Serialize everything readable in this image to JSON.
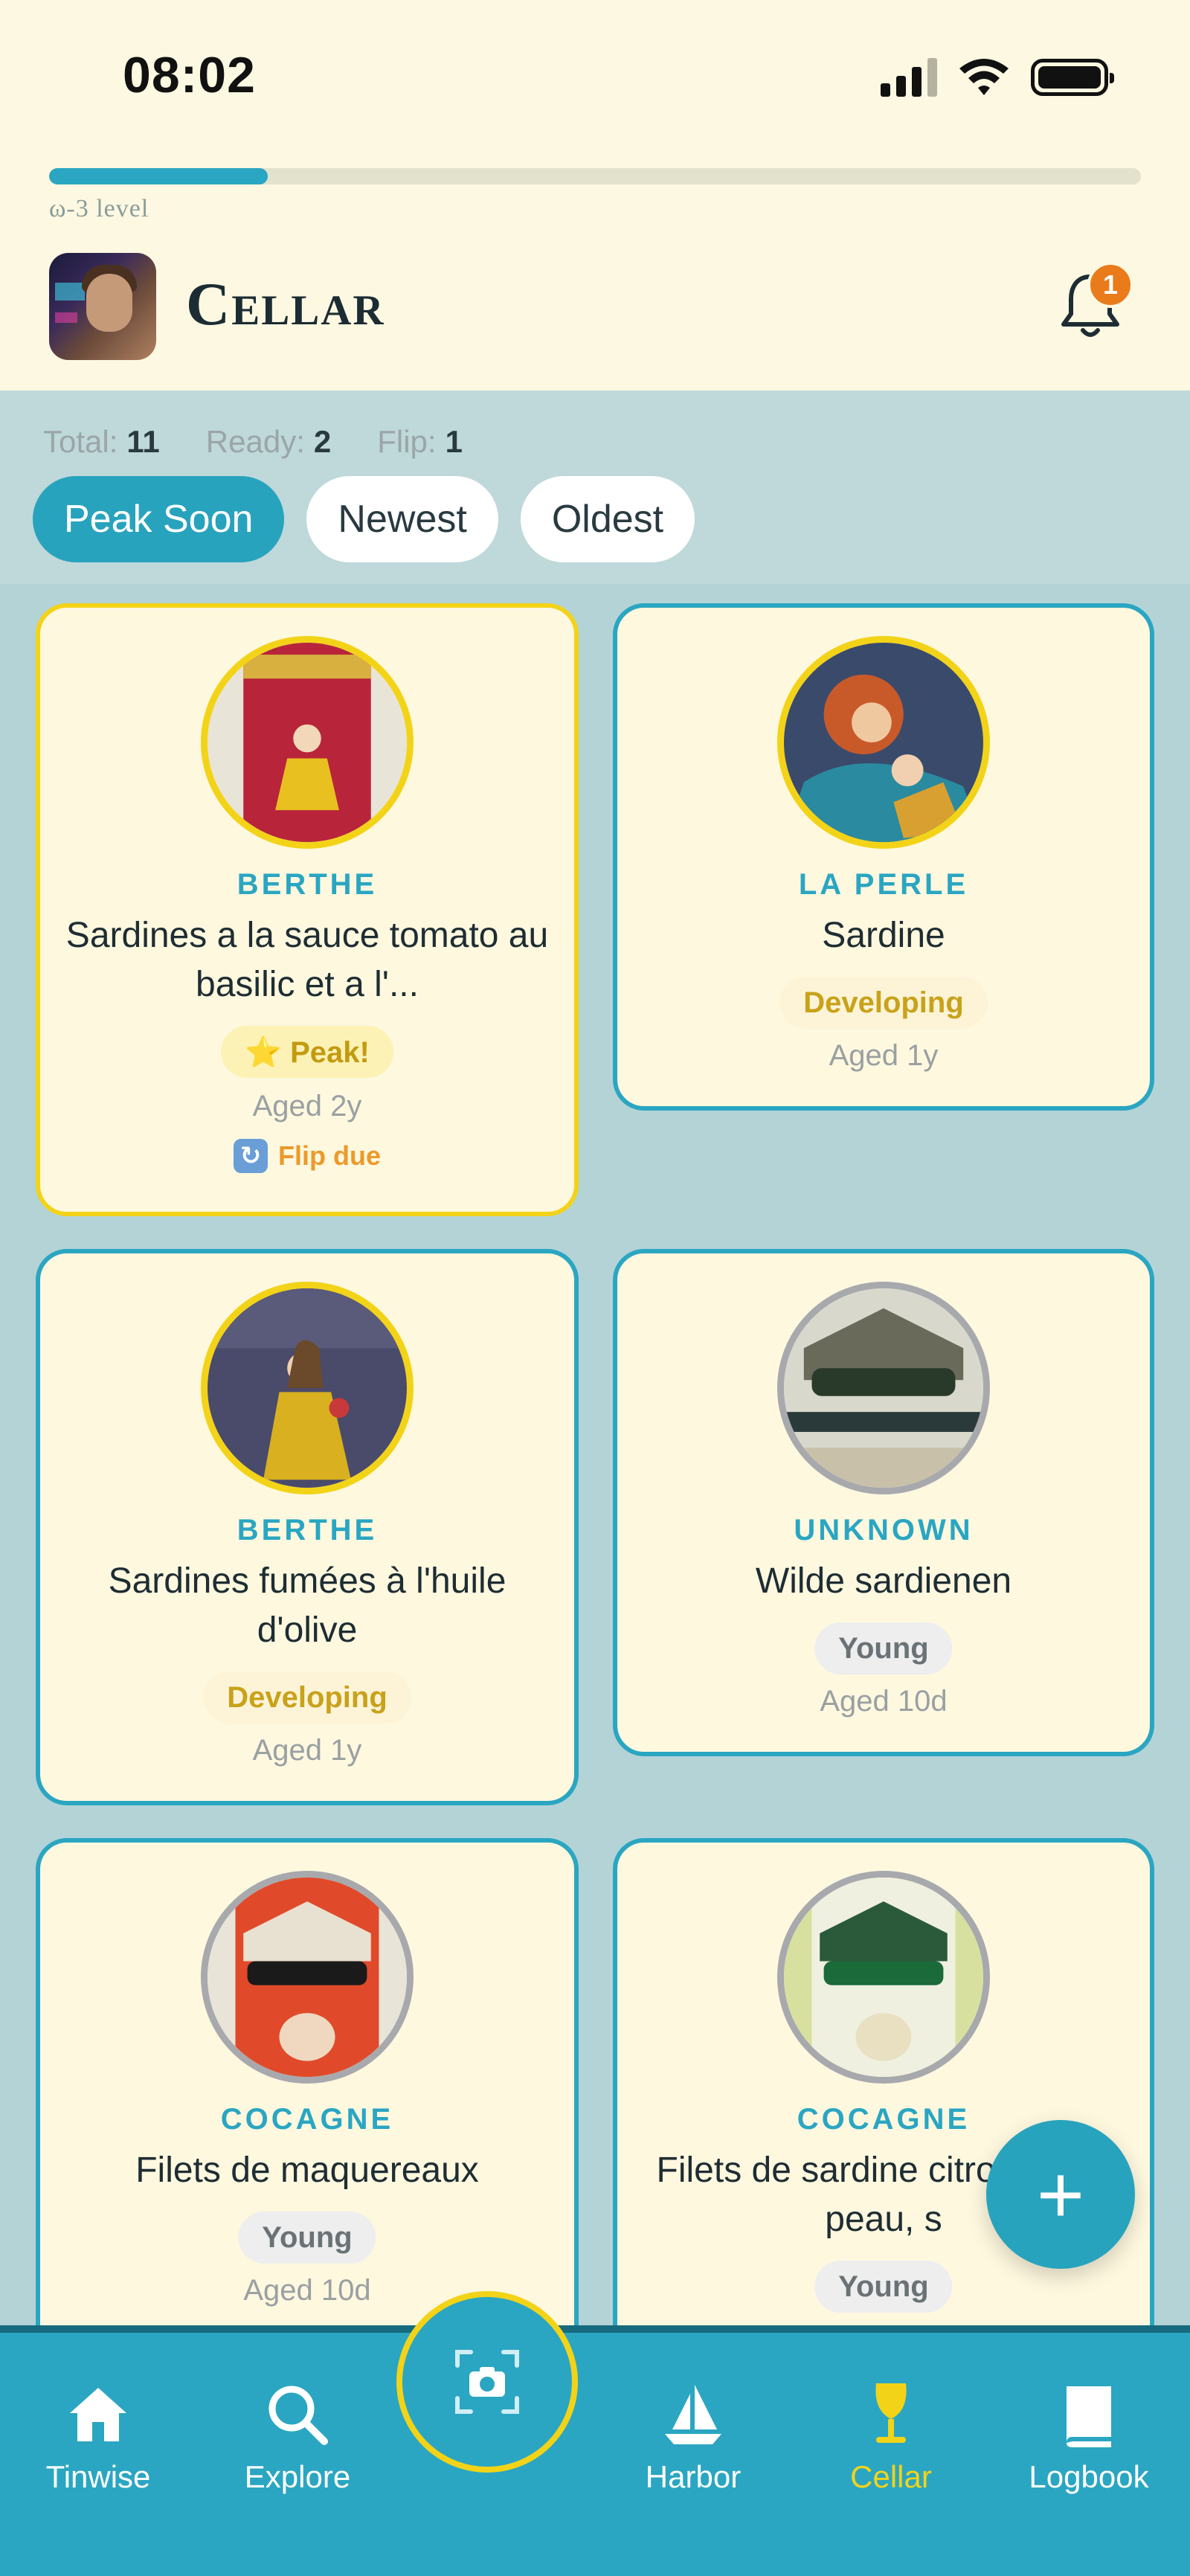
{
  "status_bar": {
    "time": "08:02"
  },
  "progress": {
    "value": 0.1,
    "label": "ω-3 level"
  },
  "header": {
    "title": "Cellar",
    "notification_count": "1"
  },
  "stats": {
    "total_label": "Total:",
    "total": "11",
    "ready_label": "Ready:",
    "ready": "2",
    "flip_label": "Flip:",
    "flip": "1"
  },
  "filters": [
    "Peak Soon",
    "Newest",
    "Oldest"
  ],
  "active_filter": "Peak Soon",
  "cards": [
    {
      "brand": "BERTHE",
      "name": "Sardines a la sauce tomato au basilic et a l'...",
      "status": "⭐ Peak!",
      "aged": "Aged 2y",
      "flip": "Flip due",
      "featured": true
    },
    {
      "brand": "LA PERLE",
      "name": "Sardine",
      "status": "Developing",
      "aged": "Aged 1y"
    },
    {
      "brand": "BERTHE",
      "name": "Sardines fumées à l'huile d'olive",
      "status": "Developing",
      "aged": "Aged 1y"
    },
    {
      "brand": "UNKNOWN",
      "name": "Wilde sardienen",
      "status": "Young",
      "aged": "Aged 10d"
    },
    {
      "brand": "COCAGNE",
      "name": "Filets de maquereaux",
      "status": "Young",
      "aged": "Aged 10d"
    },
    {
      "brand": "COCAGNE",
      "name": "Filets de sardine citron, sans peau, s",
      "status": "Young"
    }
  ],
  "tabbar": {
    "items": [
      {
        "label": "Tinwise",
        "icon": "home-icon"
      },
      {
        "label": "Explore",
        "icon": "search-icon"
      },
      {
        "label": "",
        "icon": "camera-scan-icon"
      },
      {
        "label": "Harbor",
        "icon": "sailboat-icon"
      },
      {
        "label": "Cellar",
        "icon": "wine-glass-icon",
        "active": true
      },
      {
        "label": "Logbook",
        "icon": "book-icon"
      }
    ]
  },
  "colors": {
    "accent": "#2aa6c2",
    "gold": "#f3d318",
    "badge": "#ea7b1b",
    "cream": "#fdf8e1"
  }
}
